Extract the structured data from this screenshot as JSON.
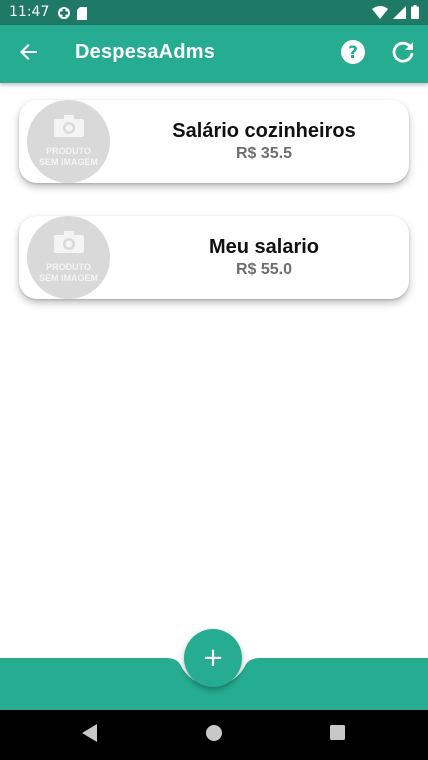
{
  "status_bar": {
    "time": "11:47",
    "icons_left": [
      "data-saver-icon",
      "sim-card-icon"
    ],
    "icons_right": [
      "wifi-icon",
      "signal-icon",
      "battery-icon"
    ]
  },
  "app_bar": {
    "title": "DespesaAdms",
    "back_icon": "arrow-back-icon",
    "help_icon": "help-circle-icon",
    "refresh_icon": "refresh-icon",
    "color": "#26ad91",
    "status_color": "#1e7a66"
  },
  "items": [
    {
      "title": "Salário cozinheiros",
      "price": "R$ 35.5",
      "image_text_line1": "PRODUTO",
      "image_text_line2": "SEM IMAGEM"
    },
    {
      "title": "Meu salario",
      "price": "R$ 55.0",
      "image_text_line1": "PRODUTO",
      "image_text_line2": "SEM IMAGEM"
    }
  ],
  "fab": {
    "label": "+",
    "icon": "add-icon"
  },
  "nav_bar": {
    "buttons": [
      "back-triangle-icon",
      "home-circle-icon",
      "recents-square-icon"
    ]
  }
}
